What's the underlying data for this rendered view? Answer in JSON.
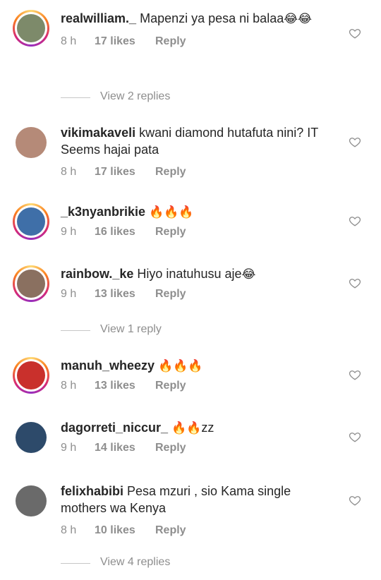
{
  "comments": [
    {
      "username": "realwilliam._",
      "text": "Mapenzi ya pesa ni balaa",
      "emoji": "😂😂",
      "time": "8 h",
      "likes": "17 likes",
      "reply": "Reply",
      "avatar_color": "#7d8a6a",
      "story_ring": true
    },
    {
      "username": "vikimakaveli",
      "text": "kwani diamond hutafuta nini? IT Seems hajai pata",
      "emoji": "",
      "time": "8 h",
      "likes": "17 likes",
      "reply": "Reply",
      "avatar_color": "#b58a78",
      "story_ring": false
    },
    {
      "username": "_k3nyanbrikie",
      "text": "",
      "emoji": "🔥🔥🔥",
      "time": "9 h",
      "likes": "16 likes",
      "reply": "Reply",
      "avatar_color": "#3f6fa8",
      "story_ring": true
    },
    {
      "username": "rainbow._ke",
      "text": "Hiyo inatuhusu aje",
      "emoji": "😂",
      "time": "9 h",
      "likes": "13 likes",
      "reply": "Reply",
      "avatar_color": "#8a7060",
      "story_ring": true
    },
    {
      "username": "manuh_wheezy",
      "text": "",
      "emoji": "🔥🔥🔥",
      "time": "8 h",
      "likes": "13 likes",
      "reply": "Reply",
      "avatar_color": "#c9302c",
      "story_ring": true
    },
    {
      "username": "dagorreti_niccur_",
      "text": "",
      "emoji": "🔥🔥",
      "suffix": "zz",
      "time": "9 h",
      "likes": "14 likes",
      "reply": "Reply",
      "avatar_color": "#2d4a6a",
      "story_ring": false
    },
    {
      "username": "felixhabibi",
      "text": "Pesa mzuri , sio Kama single mothers wa Kenya",
      "emoji": "",
      "time": "8 h",
      "likes": "10 likes",
      "reply": "Reply",
      "avatar_color": "#6a6a6a",
      "story_ring": false
    }
  ],
  "view_replies": [
    "View 2 replies",
    "View 1 reply",
    "View 4 replies"
  ],
  "colors": {
    "text": "#262626",
    "secondary": "#8e8e8e",
    "divider": "#c7c7c7"
  }
}
